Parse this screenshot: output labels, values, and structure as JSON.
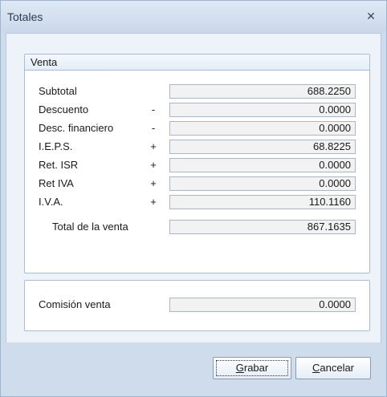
{
  "window": {
    "title": "Totales",
    "close_glyph": "✕"
  },
  "venta": {
    "group_title": "Venta",
    "rows": [
      {
        "label": "Subtotal",
        "sign": "",
        "value": "688.2250"
      },
      {
        "label": "Descuento",
        "sign": "-",
        "value": "0.0000"
      },
      {
        "label": "Desc. financiero",
        "sign": "-",
        "value": "0.0000"
      },
      {
        "label": "I.E.P.S.",
        "sign": "+",
        "value": "68.8225"
      },
      {
        "label": "Ret. ISR",
        "sign": "+",
        "value": "0.0000"
      },
      {
        "label": "Ret IVA",
        "sign": "+",
        "value": "0.0000"
      },
      {
        "label": "I.V.A.",
        "sign": "+",
        "value": "110.1160"
      }
    ],
    "total_label": "Total de la venta",
    "total_value": "867.1635"
  },
  "comision": {
    "label": "Comisión venta",
    "value": "0.0000"
  },
  "buttons": {
    "save_mnemonic": "G",
    "save_rest": "rabar",
    "cancel_mnemonic": "C",
    "cancel_rest": "ancelar"
  }
}
